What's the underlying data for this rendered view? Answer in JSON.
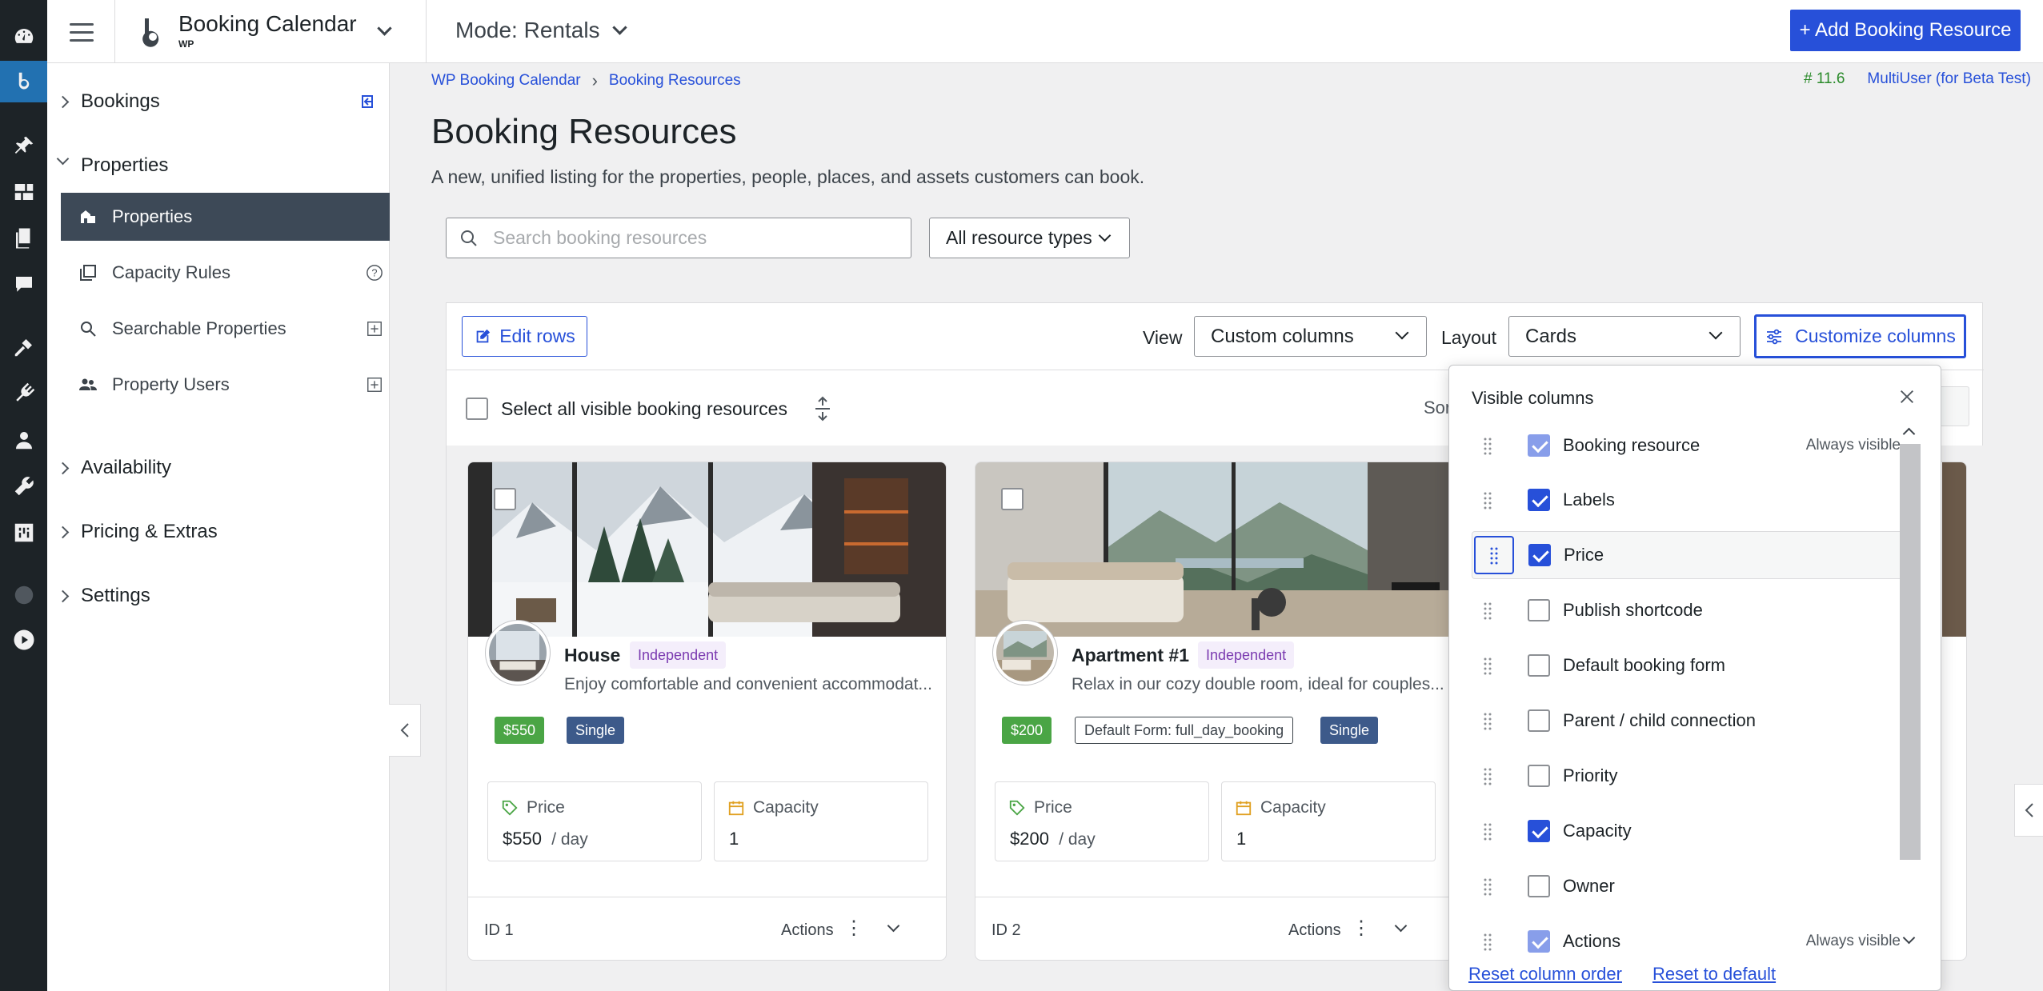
{
  "app": {
    "brand_title": "Booking Calendar",
    "brand_sub": "WP",
    "mode_label": "Mode: Rentals",
    "add_button": "+ Add Booking Resource"
  },
  "sidebar": {
    "groups": {
      "bookings": "Bookings",
      "properties": "Properties",
      "availability": "Availability",
      "pricing": "Pricing & Extras",
      "settings": "Settings"
    },
    "items": [
      {
        "label": "Properties",
        "icon": "properties-icon",
        "active": true
      },
      {
        "label": "Capacity Rules",
        "icon": "capacity-rules-icon",
        "trailing": "help-icon"
      },
      {
        "label": "Searchable Properties",
        "icon": "search-icon",
        "trailing": "add-icon"
      },
      {
        "label": "Property Users",
        "icon": "users-icon",
        "trailing": "add-icon"
      }
    ]
  },
  "breadcrumb": {
    "root": "WP Booking Calendar",
    "current": "Booking Resources"
  },
  "version": {
    "number": "# 11.6",
    "edition": "MultiUser (for Beta Test)"
  },
  "page": {
    "title": "Booking Resources",
    "description": "A new, unified listing for the properties, people, places, and assets customers can book."
  },
  "filters": {
    "search_placeholder": "Search booking resources",
    "type_select": "All resource types"
  },
  "toolbar": {
    "edit_rows": "Edit rows",
    "view_label": "View",
    "view_value": "Custom columns",
    "layout_label": "Layout",
    "layout_value": "Cards",
    "customize": "Customize columns"
  },
  "list": {
    "select_all": "Select all visible booking resources",
    "sort_label": "Sor"
  },
  "cards": [
    {
      "name": "House",
      "badge": "Independent",
      "description": "Enjoy comfortable and convenient accommodat...",
      "price_pill": "$550",
      "type_pill": "Single",
      "price_title": "Price",
      "price_value": "$550",
      "price_unit": "/ day",
      "capacity_title": "Capacity",
      "capacity_value": "1",
      "id": "ID 1",
      "actions": "Actions"
    },
    {
      "name": "Apartment #1",
      "badge": "Independent",
      "description": "Relax in our cozy double room, ideal for couples...",
      "price_pill": "$200",
      "form_pill": "Default Form: full_day_booking",
      "type_pill": "Single",
      "price_title": "Price",
      "price_value": "$200",
      "price_unit": "/ day",
      "capacity_title": "Capacity",
      "capacity_value": "1",
      "id": "ID 2",
      "actions": "Actions"
    }
  ],
  "columns_popover": {
    "title": "Visible columns",
    "always_visible": "Always visible",
    "columns": [
      {
        "name": "Booking resource",
        "checked": true,
        "locked": true
      },
      {
        "name": "Labels",
        "checked": true
      },
      {
        "name": "Price",
        "checked": true
      },
      {
        "name": "Publish shortcode",
        "checked": false
      },
      {
        "name": "Default booking form",
        "checked": false
      },
      {
        "name": "Parent / child connection",
        "checked": false
      },
      {
        "name": "Priority",
        "checked": false
      },
      {
        "name": "Capacity",
        "checked": true
      },
      {
        "name": "Owner",
        "checked": false
      },
      {
        "name": "Actions",
        "checked": true,
        "locked": true
      }
    ],
    "reset_order": "Reset column order",
    "reset_default": "Reset to default"
  },
  "colors": {
    "accent": "#2750d9",
    "admin_bar": "#1d2327",
    "active_nav": "#3d4957",
    "price_green": "#4aa545",
    "single_blue": "#3d5a8a"
  }
}
